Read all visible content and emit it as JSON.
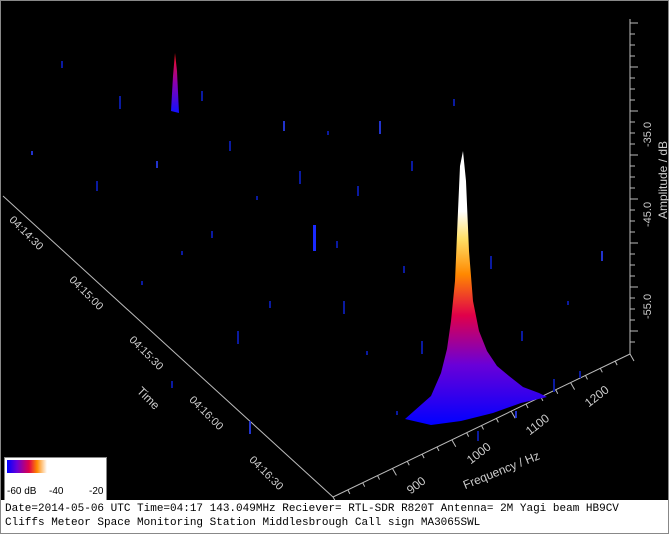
{
  "plot": {
    "time_axis": {
      "label": "Time",
      "ticks": [
        "04:14:30",
        "04:15:00",
        "04:15:30",
        "04:16:00",
        "04:16:30"
      ]
    },
    "frequency_axis": {
      "label": "Frequency / Hz",
      "ticks": [
        "900",
        "1000",
        "1100",
        "1200"
      ]
    },
    "amplitude_axis": {
      "label": "Amplitude / dB",
      "ticks": [
        "-35.0",
        "-45.0",
        "-55.0"
      ]
    },
    "colors": {
      "low": "#0000ff",
      "mid": "#e0004a",
      "high": "#ff8800",
      "peak": "#ffffff"
    }
  },
  "legend": {
    "ticks": [
      "-60 dB",
      "-40",
      "-20"
    ]
  },
  "caption": {
    "line1": "Date=2014-05-06 UTC Time=04:17 143.049MHz Reciever= RTL-SDR R820T Antenna= 2M Yagi beam HB9CV",
    "line2": "Cliffs Meteor Space Monitoring Station Middlesbrough Call sign MA3065SWL"
  }
}
